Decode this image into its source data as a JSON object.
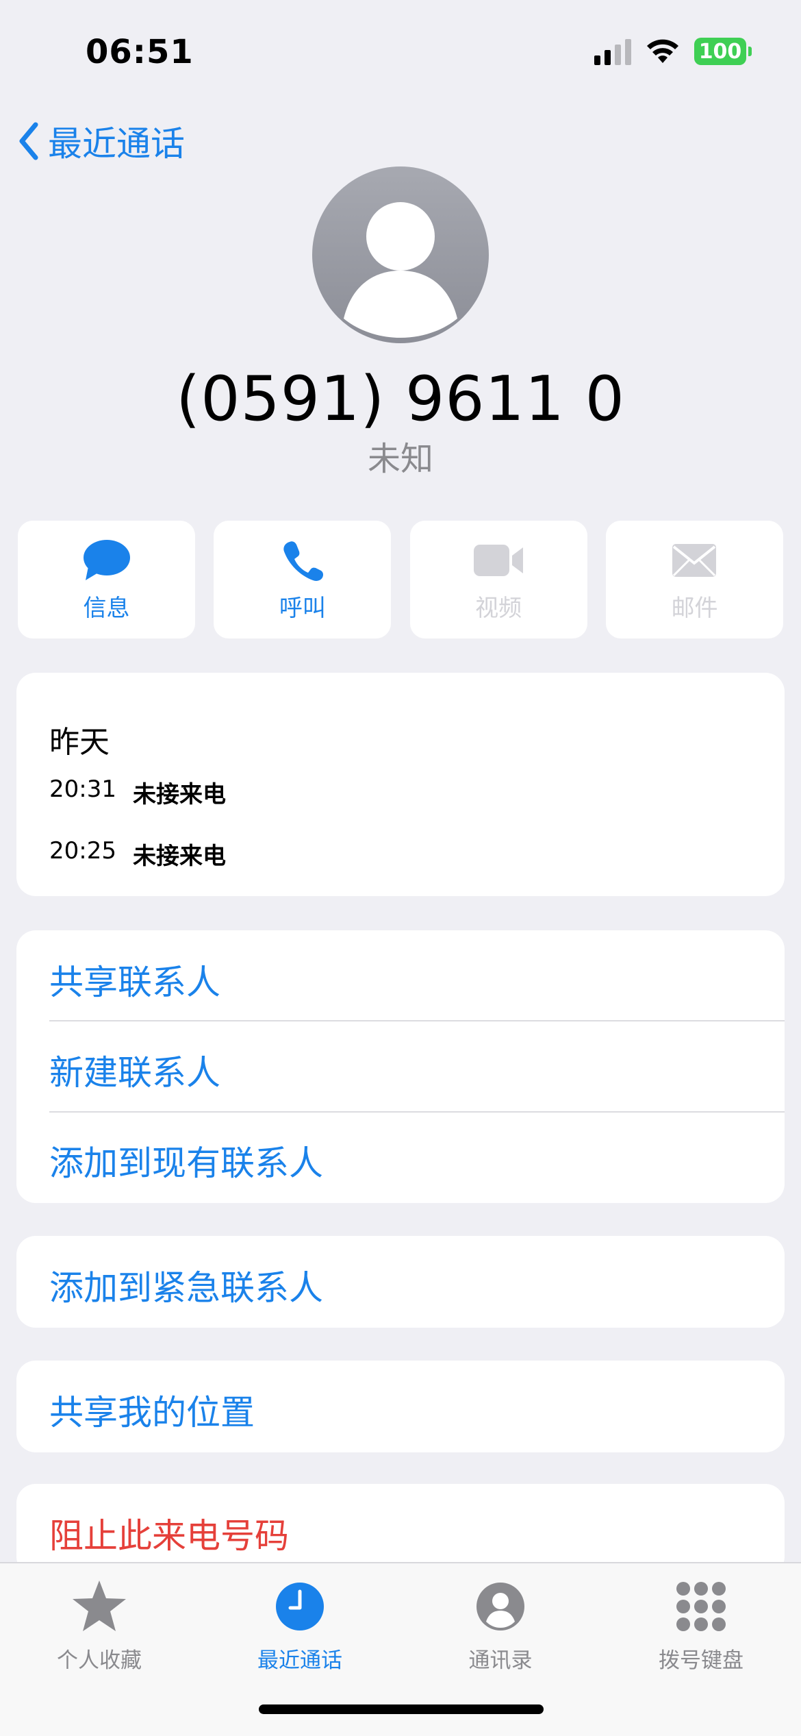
{
  "status_bar": {
    "time": "06:51",
    "battery": "100",
    "battery_color": "#3fcf54"
  },
  "nav": {
    "back_label": "最近通话",
    "back_icon": "chevron-left-icon"
  },
  "contact": {
    "avatar_icon": "person-silhouette-icon",
    "phone_number": "(0591) 9611 0",
    "label": "未知"
  },
  "actions": [
    {
      "label": "信息",
      "icon": "message-bubble-icon",
      "enabled": true
    },
    {
      "label": "呼叫",
      "icon": "phone-icon",
      "enabled": true
    },
    {
      "label": "视频",
      "icon": "video-camera-icon",
      "enabled": false
    },
    {
      "label": "邮件",
      "icon": "envelope-icon",
      "enabled": false
    }
  ],
  "call_history": {
    "date": "昨天",
    "entries": [
      {
        "time": "20:31",
        "type": "未接来电"
      },
      {
        "time": "20:25",
        "type": "未接来电"
      }
    ]
  },
  "contact_options": {
    "share_contact": "共享联系人",
    "new_contact": "新建联系人",
    "add_existing": "添加到现有联系人"
  },
  "emergency": {
    "add_emergency": "添加到紧急联系人"
  },
  "location": {
    "share_location": "共享我的位置"
  },
  "block": {
    "block_caller": "阻止此来电号码"
  },
  "tab_bar": {
    "tabs": [
      {
        "label": "个人收藏",
        "icon": "star-icon",
        "active": false
      },
      {
        "label": "最近通话",
        "icon": "clock-icon",
        "active": true
      },
      {
        "label": "通讯录",
        "icon": "person-circle-icon",
        "active": false
      },
      {
        "label": "拨号键盘",
        "icon": "keypad-icon",
        "active": false
      }
    ]
  },
  "colors": {
    "accent": "#1a82ea",
    "destructive": "#e5403a",
    "secondary_text": "#8a8a8e",
    "disabled": "#d3d3d8",
    "background": "#efeff4"
  }
}
